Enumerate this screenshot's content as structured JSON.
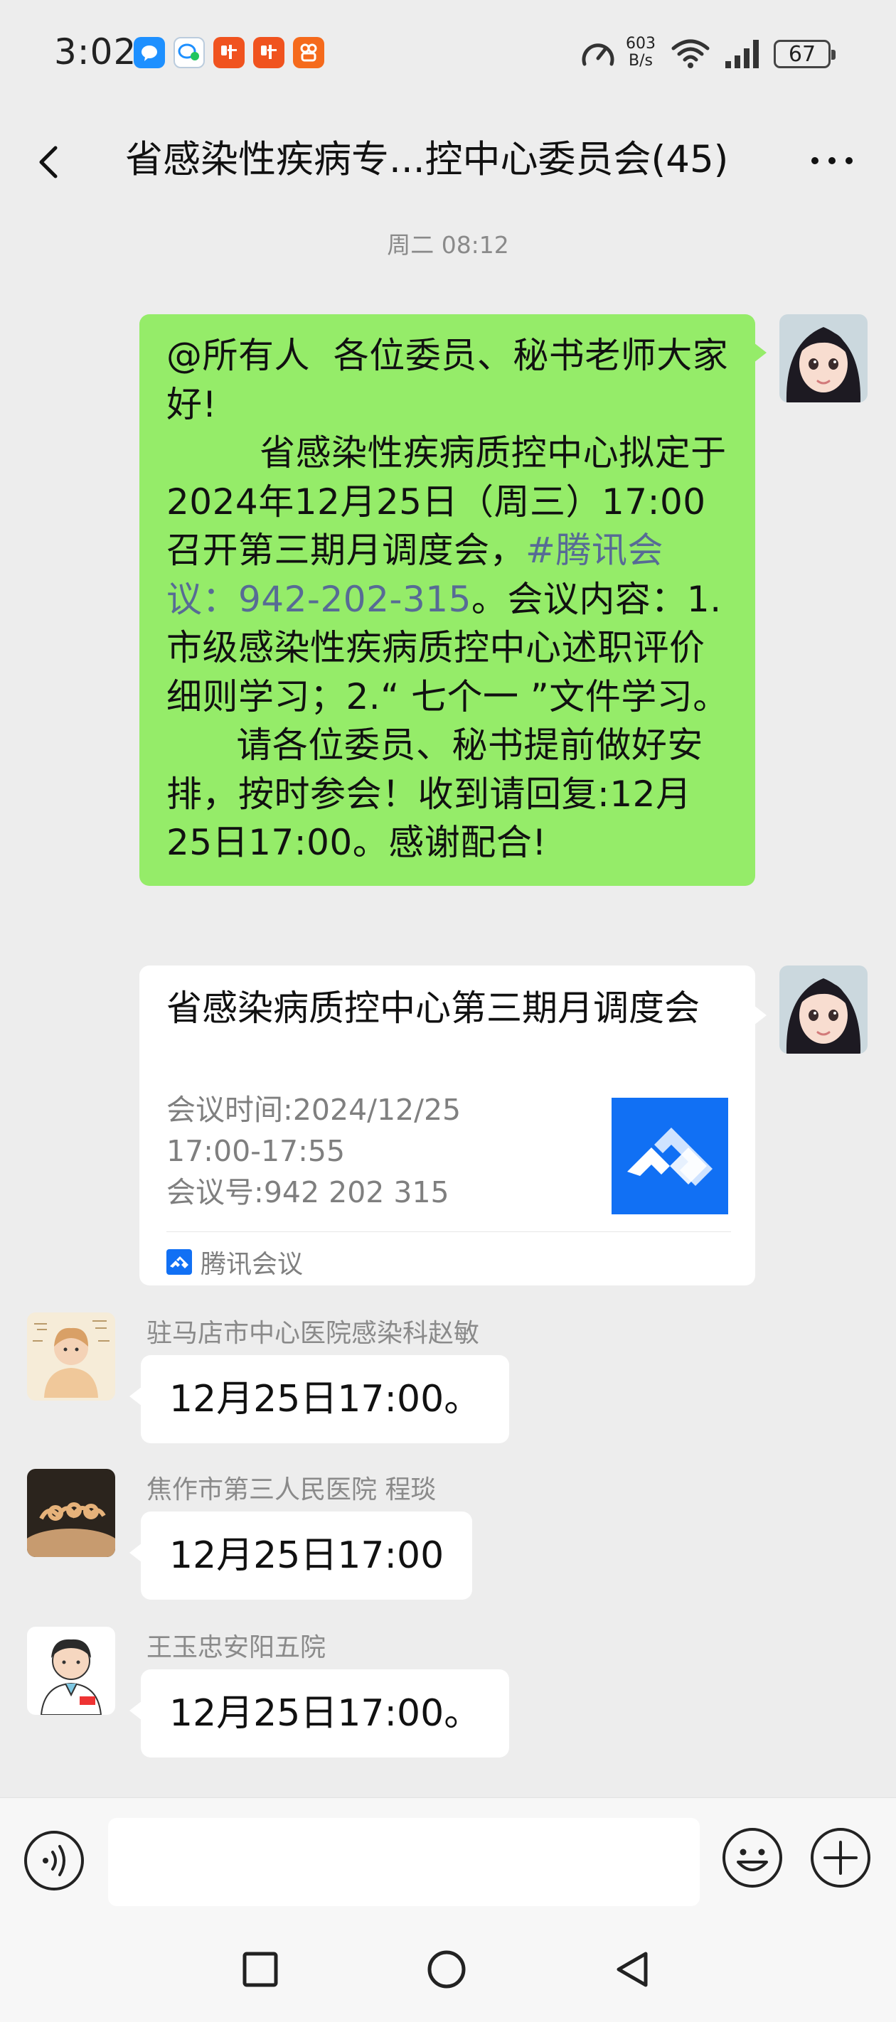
{
  "status_bar": {
    "time": "3:02",
    "net_speed_value": "603",
    "net_speed_unit": "B/s",
    "battery": "67",
    "notification_icons": [
      "qq-icon",
      "chat-icon",
      "ting-icon",
      "ting-icon",
      "kuaishou-icon"
    ]
  },
  "header": {
    "title": "省感染性疾病专...控中心委员会(45)",
    "back_icon": "chevron-left-icon",
    "more_icon": "more-dots-icon"
  },
  "chat": {
    "timestamp": "周二 08:12",
    "messages": [
      {
        "type": "text",
        "side": "right",
        "lines": [
          "@所有人  各位委员、秘书老师大家好!",
          "        省感染性疾病质控中心拟定于2024年12月25日（周三）17:00召开第三期月调度会，",
          "#腾讯会议：942-202-315",
          "。会议内容：1.市级感染性疾病质控中心述职评价细则学习；2.“ 七个一 ”文件学习。",
          "      请各位委员、秘书提前做好安排，按时参会！收到请回复:12月25日17:00。感谢配合!"
        ]
      },
      {
        "type": "card",
        "side": "right",
        "title": "省感染病质控中心第三期月调度会",
        "detail_time_label": "会议时间:2024/12/25",
        "detail_time_range": "17:00-17:55",
        "detail_number": "会议号:942 202 315",
        "source": "腾讯会议"
      },
      {
        "type": "text",
        "side": "left",
        "sender": "驻马店市中心医院感染科赵敏",
        "text": "12月25日17:00。"
      },
      {
        "type": "text",
        "side": "left",
        "sender": "焦作市第三人民医院 程琰",
        "text": "12月25日17:00"
      },
      {
        "type": "text",
        "side": "left",
        "sender": "王玉忠安阳五院",
        "text": "12月25日17:00。"
      }
    ]
  },
  "input_bar": {
    "placeholder": "",
    "voice_icon": "voice-icon",
    "emoji_icon": "emoji-icon",
    "plus_icon": "plus-icon"
  },
  "system_nav": {
    "recent_icon": "square-icon",
    "home_icon": "circle-icon",
    "back_icon": "triangle-back-icon"
  },
  "colors": {
    "background": "#ededed",
    "sent_bubble": "#95ec69",
    "received_bubble": "#ffffff",
    "link": "#576b95",
    "tencent_meeting_blue": "#1170f4"
  }
}
